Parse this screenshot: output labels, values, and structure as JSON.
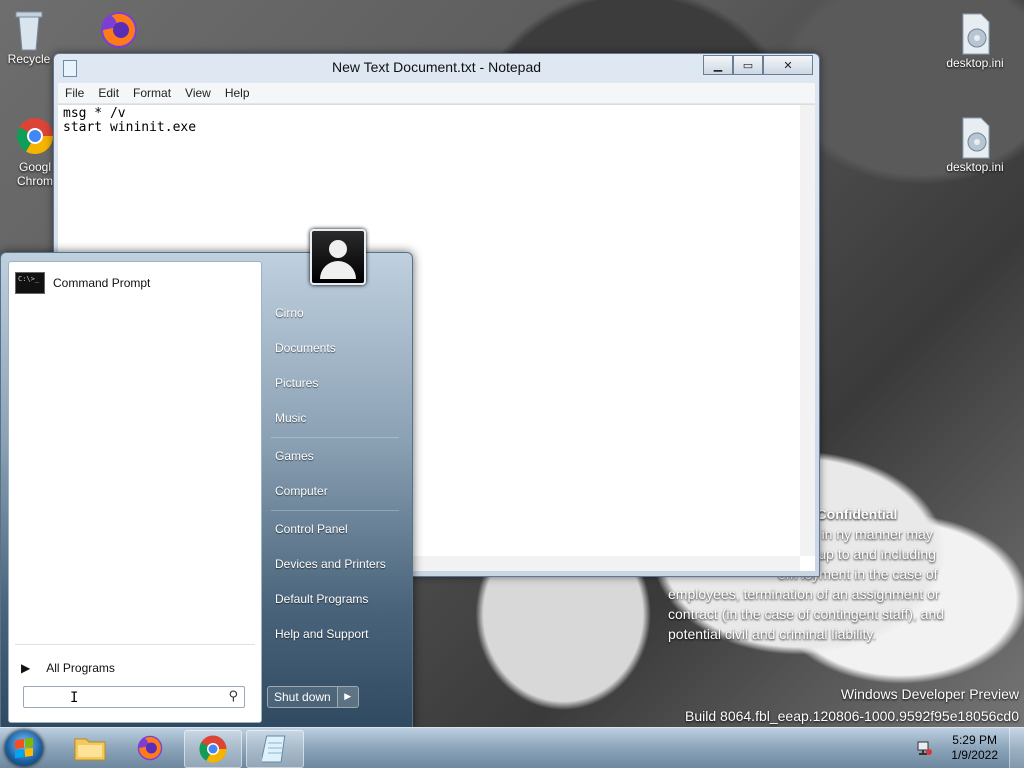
{
  "desktop": {
    "icons": [
      {
        "label": "Recycle"
      },
      {
        "label": "Googl Chrom"
      },
      {
        "label": "desktop.ini"
      },
      {
        "label": "desktop.ini"
      }
    ]
  },
  "notepad": {
    "title": "New Text Document.txt - Notepad",
    "menu": [
      "File",
      "Edit",
      "Format",
      "View",
      "Help"
    ],
    "content": "msg * /v\nstart wininit.exe",
    "controls": {
      "minimize": "▁",
      "maximize": "▭",
      "close": "✕"
    }
  },
  "start_menu": {
    "pinned": [
      {
        "label": "Command Prompt",
        "icon": "cmd-icon"
      }
    ],
    "all_programs": "All Programs",
    "search": {
      "value": "",
      "placeholder": ""
    },
    "right": [
      "Cirno",
      "Documents",
      "Pictures",
      "Music",
      "Games",
      "Computer",
      "Control Panel",
      "Devices and Printers",
      "Default Programs",
      "Help and Support"
    ],
    "shutdown": "Shut down"
  },
  "watermark": {
    "confidential_title": "t Confidential",
    "confidential_lines": [
      "isclo e in ny manner may",
      "tion; up to and including",
      "em loyment in the case of",
      "employees, termination of an assignment or",
      "contract (in the case of contingent staff), and",
      "potential civil and criminal liability."
    ],
    "line1": "Windows Developer Preview",
    "line2": "Build 8064.fbl_eeap.120806-1000.9592f95e18056cd0"
  },
  "taskbar": {
    "time": "5:29 PM",
    "date": "1/9/2022"
  },
  "colors": {
    "accent": "#1b5fa0",
    "taskbar": "#8ca5bb"
  }
}
